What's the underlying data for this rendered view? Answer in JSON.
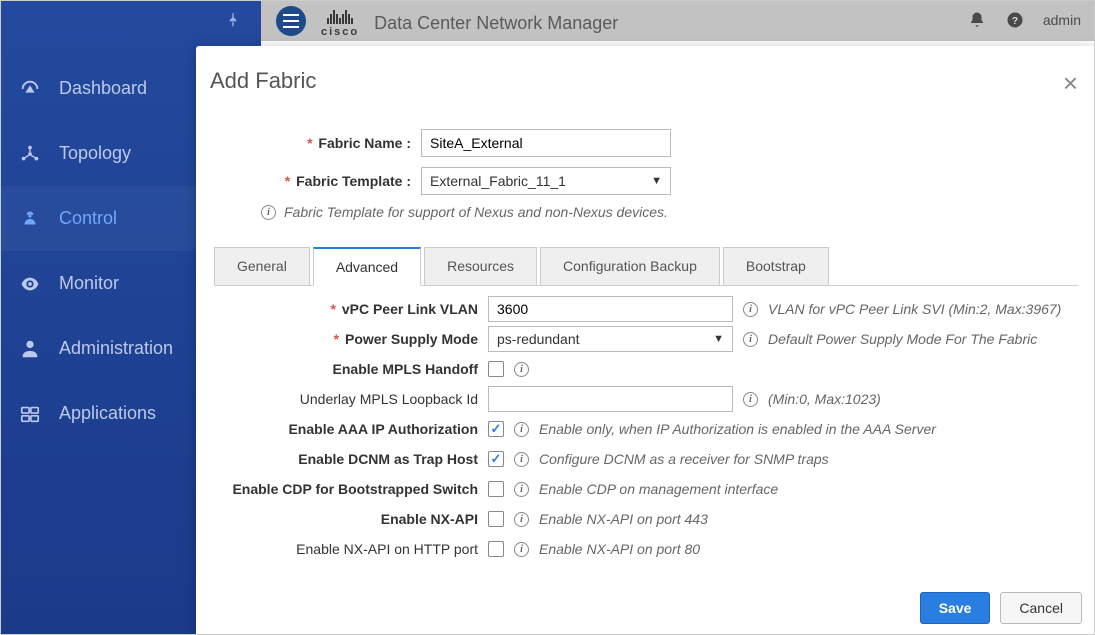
{
  "app_title": "Data Center Network Manager",
  "brand": "cisco",
  "user": "admin",
  "sidebar": {
    "items": [
      {
        "label": "Dashboard"
      },
      {
        "label": "Topology"
      },
      {
        "label": "Control"
      },
      {
        "label": "Monitor"
      },
      {
        "label": "Administration"
      },
      {
        "label": "Applications"
      }
    ],
    "active_index": 2
  },
  "modal": {
    "title": "Add Fabric",
    "fabric_name_label": "Fabric Name :",
    "fabric_name_value": "SiteA_External",
    "fabric_template_label": "Fabric Template :",
    "fabric_template_value": "External_Fabric_11_1",
    "template_hint": "Fabric Template for support of Nexus and non-Nexus devices."
  },
  "tabs": {
    "items": [
      {
        "label": "General"
      },
      {
        "label": "Advanced"
      },
      {
        "label": "Resources"
      },
      {
        "label": "Configuration Backup"
      },
      {
        "label": "Bootstrap"
      }
    ],
    "active_index": 1
  },
  "advanced": {
    "rows": [
      {
        "label": "vPC Peer Link VLAN",
        "required": true,
        "bold": true,
        "type": "text",
        "value": "3600",
        "desc": "VLAN for vPC Peer Link SVI (Min:2, Max:3967)"
      },
      {
        "label": "Power Supply Mode",
        "required": true,
        "bold": true,
        "type": "select",
        "value": "ps-redundant",
        "desc": "Default Power Supply Mode For The Fabric"
      },
      {
        "label": "Enable MPLS Handoff",
        "required": false,
        "bold": true,
        "type": "checkbox",
        "checked": false,
        "desc": ""
      },
      {
        "label": "Underlay MPLS Loopback Id",
        "required": false,
        "bold": false,
        "type": "text",
        "value": "",
        "desc": "(Min:0, Max:1023)"
      },
      {
        "label": "Enable AAA IP Authorization",
        "required": false,
        "bold": true,
        "type": "checkbox",
        "checked": true,
        "desc": "Enable only, when IP Authorization is enabled in the AAA Server"
      },
      {
        "label": "Enable DCNM as Trap Host",
        "required": false,
        "bold": true,
        "type": "checkbox",
        "checked": true,
        "desc": "Configure DCNM as a receiver for SNMP traps"
      },
      {
        "label": "Enable CDP for Bootstrapped Switch",
        "required": false,
        "bold": true,
        "type": "checkbox",
        "checked": false,
        "desc": "Enable CDP on management interface"
      },
      {
        "label": "Enable NX-API",
        "required": false,
        "bold": true,
        "type": "checkbox",
        "checked": false,
        "desc": "Enable NX-API on port 443"
      },
      {
        "label": "Enable NX-API on HTTP port",
        "required": false,
        "bold": false,
        "type": "checkbox",
        "checked": false,
        "desc": "Enable NX-API on port 80"
      }
    ]
  },
  "footer": {
    "save": "Save",
    "cancel": "Cancel"
  }
}
